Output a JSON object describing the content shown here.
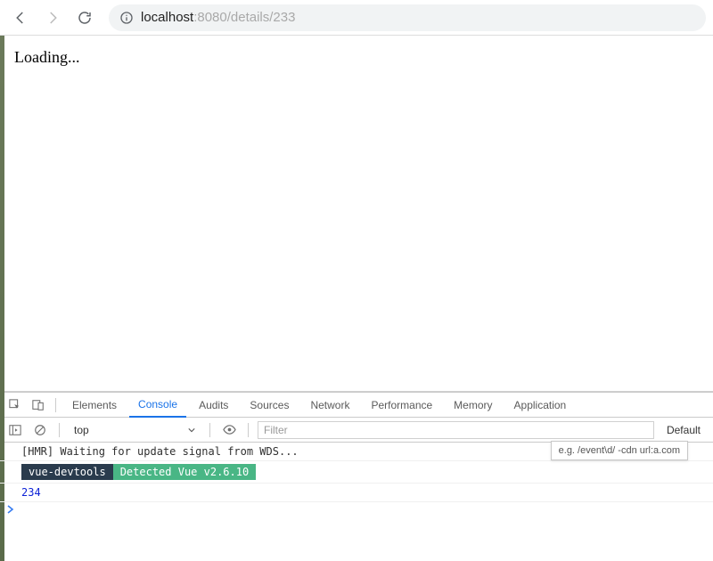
{
  "browser": {
    "url_host": "localhost",
    "url_rest": ":8080/details/233"
  },
  "page": {
    "loading_text": "Loading..."
  },
  "devtools": {
    "tabs": [
      "Elements",
      "Console",
      "Audits",
      "Sources",
      "Network",
      "Performance",
      "Memory",
      "Application"
    ],
    "active_tab": "Console",
    "toolbar": {
      "context": "top",
      "filter_placeholder": "Filter",
      "filter_tooltip": "e.g. /event\\d/ -cdn url:a.com",
      "level": "Default"
    },
    "console": {
      "lines": [
        {
          "type": "text",
          "text": "[HMR] Waiting for update signal from WDS..."
        },
        {
          "type": "badge",
          "dark": "vue-devtools",
          "green": " Detected Vue v2.6.10 "
        },
        {
          "type": "number",
          "text": "234"
        }
      ],
      "prompt": ">"
    }
  }
}
